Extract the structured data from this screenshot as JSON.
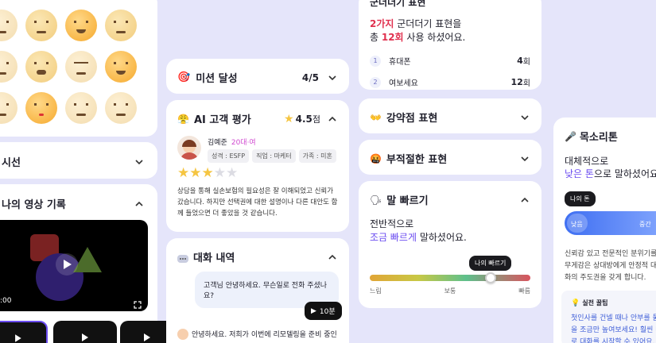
{
  "col1": {
    "section_gaze": "시선",
    "section_video": "나의 영상 기록",
    "video_time": ":00"
  },
  "mission": {
    "title": "미션 달성",
    "count": "4/5",
    "target_emoji": "🎯"
  },
  "ai_eval": {
    "title": "AI 고객 평가",
    "icon": "😤",
    "score": "4.5",
    "score_unit": "점",
    "name": "김예준",
    "age": "20대·여",
    "chips": [
      "성격 : ESFP",
      "직업 : 마케터",
      "가족 : 미혼"
    ],
    "stars": 3,
    "comment": "상담을 통해 실손보험의 필요성은 잘 이해되었고 신뢰가 갔습니다. 하지만 선택권에 대한 설명이나 다른 대안도 함께 들었으면 더 좋았을 것 같습니다."
  },
  "chat": {
    "title": "대화 내역",
    "msg1": "고객님 안녕하세요. 무슨일로 전화 주셨나요?",
    "duration": "10분",
    "msg2": "안녕하세요. 저희가 이번에 리모델링을 준비 중인"
  },
  "filler": {
    "title": "군더더기 표현",
    "line1_num": "2가지",
    "line1_rest": " 군더더기 표현을",
    "line2_pre": "총 ",
    "line2_num": "12회",
    "line2_rest": " 사용 하셨어요.",
    "items": [
      {
        "idx": "1",
        "word": "휴대폰",
        "count": "4",
        "unit": "회"
      },
      {
        "idx": "2",
        "word": "여보세요",
        "count": "12",
        "unit": "회"
      }
    ]
  },
  "strength": {
    "title": "강약점 표현",
    "icon": "👐"
  },
  "improper": {
    "title": "부적절한 표현",
    "icon": "🤬"
  },
  "speed": {
    "title": "말 빠르기",
    "icon": "🗣",
    "line1": "전반적으로",
    "highlight": "조금 빠르게",
    "line2_rest": " 말하셨어요.",
    "tooltip": "나의 빠르기",
    "labels": [
      "느림",
      "보통",
      "빠름"
    ],
    "level": 0.75
  },
  "voice": {
    "title": "목소리톤",
    "icon": "🎤",
    "line1": "대체적으로",
    "highlight": "낮은 톤",
    "line2_rest": "으로 말하셨어요.",
    "tooltip": "나의 톤",
    "bar_left": "낮음",
    "bar_right": "중간",
    "desc": "신뢰감 있고 전문적인 분위기를 무게감은 상대방에게 안정적 대화의 주도권을 갖게 합니다.",
    "tip_title": "실전 꿀팁",
    "tip_body": "첫인사를 건넬 때나 안부를 물 을 조금만 높여보세요! 훨씬 더 로 대화를 시작할 수 있어요."
  }
}
